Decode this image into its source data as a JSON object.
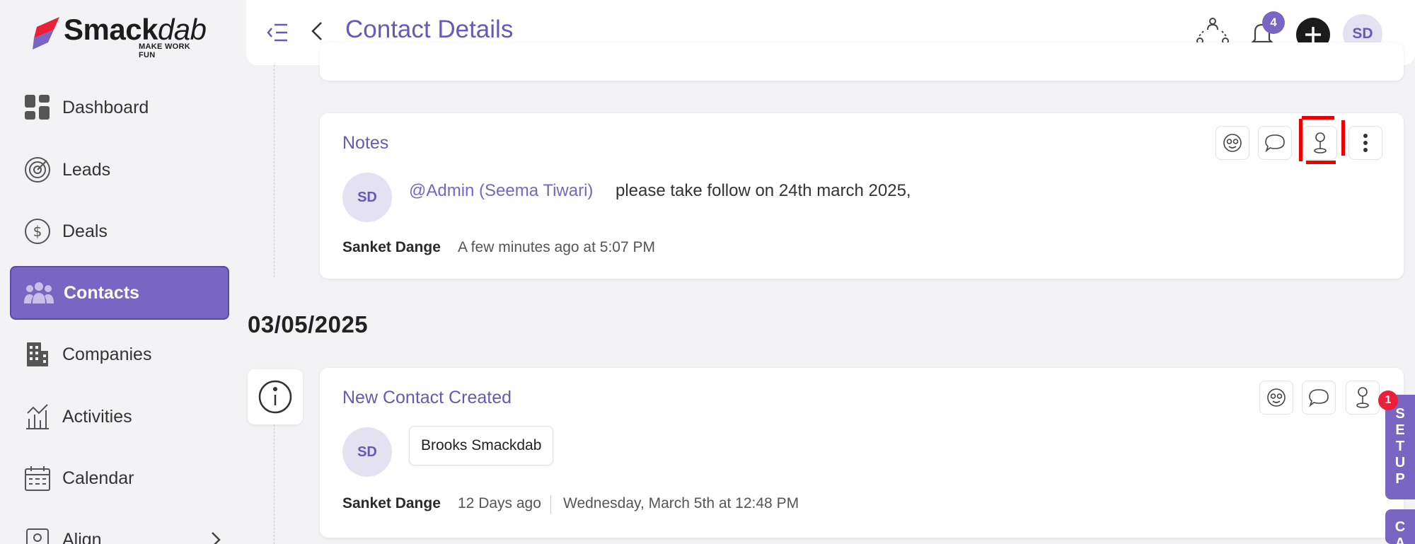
{
  "brand": {
    "name_bold": "Smack",
    "name_italic": "dab",
    "tagline": "MAKE WORK FUN",
    "accent": "#7866c2"
  },
  "sidebar": {
    "items": [
      {
        "label": "Dashboard",
        "icon": "dashboard-icon"
      },
      {
        "label": "Leads",
        "icon": "target-icon"
      },
      {
        "label": "Deals",
        "icon": "dollar-icon"
      },
      {
        "label": "Contacts",
        "icon": "people-icon",
        "active": true
      },
      {
        "label": "Companies",
        "icon": "building-icon"
      },
      {
        "label": "Activities",
        "icon": "activity-chart-icon"
      },
      {
        "label": "Calendar",
        "icon": "calendar-icon"
      },
      {
        "label": "Align",
        "icon": "align-icon"
      }
    ]
  },
  "header": {
    "title": "Contact Details",
    "notification_count": "4",
    "avatar_initials": "SD"
  },
  "notes_card": {
    "title": "Notes",
    "avatar_initials": "SD",
    "mention": "@Admin (Seema Tiwari)",
    "text": "please take follow on 24th march 2025,",
    "author": "Sanket Dange",
    "time": "A few minutes ago at 5:07 PM"
  },
  "date_group": "03/05/2025",
  "new_contact_card": {
    "title": "New Contact Created",
    "avatar_initials": "SD",
    "contact_chip": "Brooks Smackdab",
    "author": "Sanket Dange",
    "relative_time": "12 Days ago",
    "full_time": "Wednesday, March 5th at 12:48 PM"
  },
  "side_tabs": {
    "setup_letters": [
      "S",
      "E",
      "T",
      "U",
      "P"
    ],
    "second_letters": [
      "C",
      "A"
    ],
    "setup_badge": "1"
  }
}
